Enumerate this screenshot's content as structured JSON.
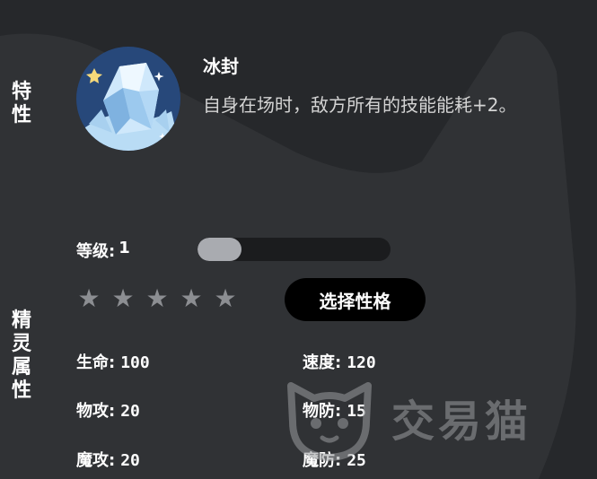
{
  "side_labels": {
    "trait": [
      "特",
      "性"
    ],
    "attributes": [
      "精",
      "灵",
      "属",
      "性"
    ]
  },
  "trait": {
    "name": "冰封",
    "description": "自身在场时，敌方所有的技能能耗+2。",
    "icon": "ice-crystal-icon"
  },
  "level": {
    "label": "等级:",
    "value": "1",
    "progress": 0.23
  },
  "stars": {
    "total": 5,
    "filled": 0,
    "glyph": "★",
    "color": "#8c8e92"
  },
  "nature_button": {
    "label": "选择性格"
  },
  "stats": [
    {
      "label": "生命:",
      "value": "100"
    },
    {
      "label": "速度:",
      "value": "120"
    },
    {
      "label": "物攻:",
      "value": "20"
    },
    {
      "label": "物防:",
      "value": "15"
    },
    {
      "label": "魔攻:",
      "value": "20"
    },
    {
      "label": "魔防:",
      "value": "25"
    }
  ],
  "watermark": {
    "text": "交易猫",
    "icon": "cat-logo-icon"
  },
  "colors": {
    "background": "#26282b",
    "bar_track": "#1b1c1e",
    "bar_fill": "#a9abb0",
    "button": "#000000"
  }
}
